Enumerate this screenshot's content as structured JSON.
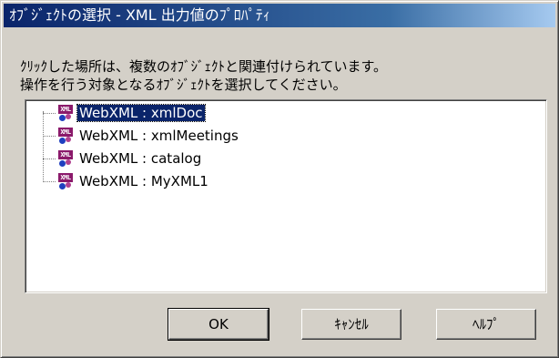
{
  "window": {
    "title": "ｵﾌﾞｼﾞｪｸﾄの選択 - XML 出力値のﾌﾟﾛﾊﾟﾃｨ"
  },
  "instructions": {
    "line1": "ｸﾘｯｸした場所は、複数のｵﾌﾞｼﾞｪｸﾄと関連付けられています。",
    "line2": "操作を行う対象となるｵﾌﾞｼﾞｪｸﾄを選択してください。"
  },
  "object_list": {
    "icon": "xml-icon",
    "items": [
      {
        "label": "WebXML : xmlDoc",
        "selected": true
      },
      {
        "label": "WebXML : xmlMeetings",
        "selected": false
      },
      {
        "label": "WebXML : catalog",
        "selected": false
      },
      {
        "label": "WebXML : MyXML1",
        "selected": false
      }
    ]
  },
  "buttons": {
    "ok": "OK",
    "cancel": "ｷｬﾝｾﾙ",
    "help": "ﾍﾙﾌﾟ"
  },
  "colors": {
    "titlebar": "#0a246a",
    "selection": "#0a246a",
    "dialog_bg": "#d4d0c8"
  }
}
